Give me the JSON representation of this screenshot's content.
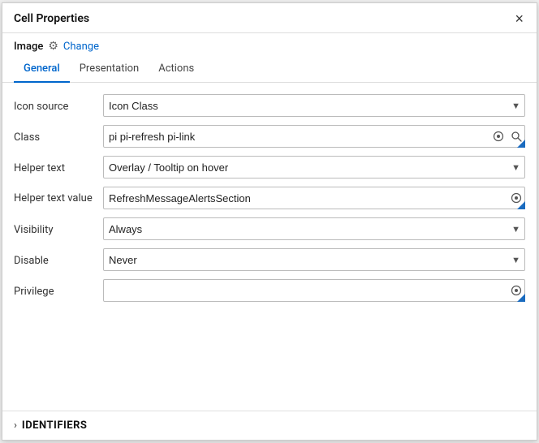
{
  "dialog": {
    "title": "Cell Properties",
    "close_label": "×"
  },
  "subheader": {
    "label": "Image",
    "settings_icon": "⚙",
    "change_link": "Change"
  },
  "tabs": [
    {
      "id": "general",
      "label": "General",
      "active": true
    },
    {
      "id": "presentation",
      "label": "Presentation",
      "active": false
    },
    {
      "id": "actions",
      "label": "Actions",
      "active": false
    }
  ],
  "fields": {
    "icon_source": {
      "label": "Icon source",
      "value": "Icon Class",
      "options": [
        "Icon Class"
      ]
    },
    "class": {
      "label": "Class",
      "value": "pi pi-refresh pi-link"
    },
    "helper_text": {
      "label": "Helper text",
      "value": "Overlay / Tooltip on hover",
      "options": [
        "Overlay / Tooltip on hover"
      ]
    },
    "helper_text_value": {
      "label": "Helper text value",
      "value": "RefreshMessageAlertsSection"
    },
    "visibility": {
      "label": "Visibility",
      "value": "Always",
      "options": [
        "Always"
      ]
    },
    "disable": {
      "label": "Disable",
      "value": "Never",
      "options": [
        "Never"
      ]
    },
    "privilege": {
      "label": "Privilege",
      "value": ""
    }
  },
  "identifiers": {
    "label": "IDENTIFIERS"
  }
}
